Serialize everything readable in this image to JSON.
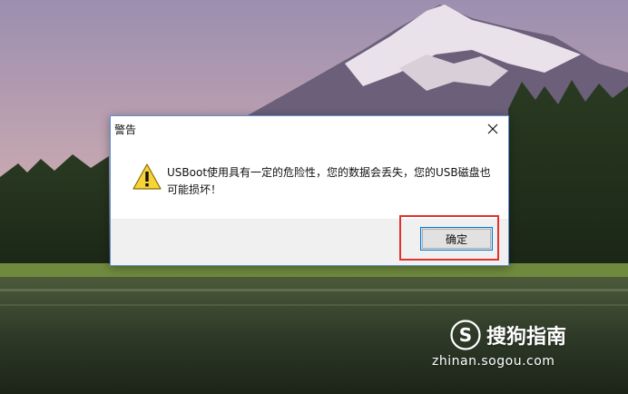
{
  "dialog": {
    "title": "警告",
    "message": "USBoot使用具有一定的危险性，您的数据会丢失，您的USB磁盘也可能损坏！",
    "ok_label": "确定",
    "close_glyph": "✕"
  },
  "icons": {
    "warning": "warning-icon",
    "close": "close-icon",
    "watermark_logo": "sogou-logo"
  },
  "watermark": {
    "title": "搜狗指南",
    "url": "zhinan.sogou.com"
  },
  "colors": {
    "highlight": "#e0322c",
    "button_border": "#0078d7",
    "dialog_border": "#5b8fd6"
  }
}
